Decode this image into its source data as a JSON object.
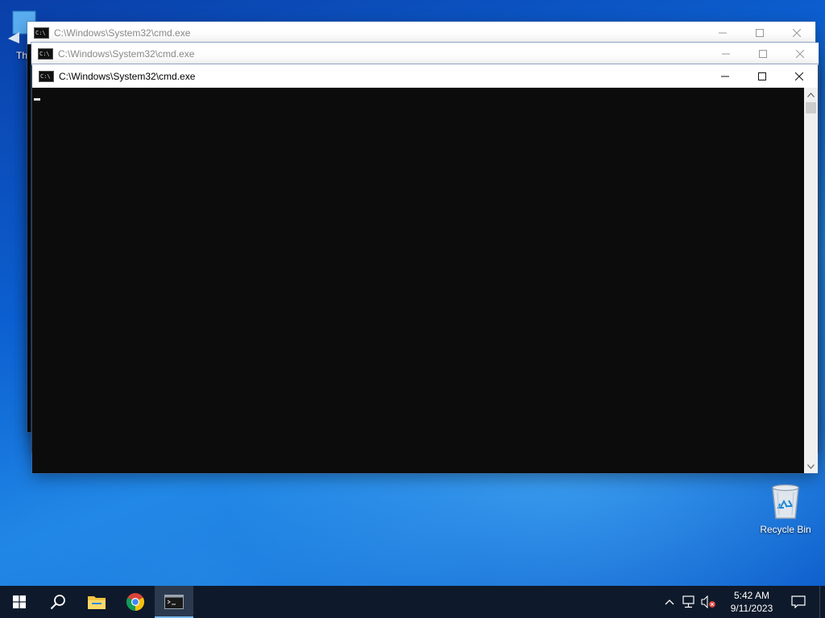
{
  "desktop": {
    "icons": [
      {
        "label": "Th"
      },
      {
        "label": "Recycle Bin"
      }
    ]
  },
  "windows": [
    {
      "title": "C:\\Windows\\System32\\cmd.exe",
      "state": "inactive"
    },
    {
      "title": "C:\\Windows\\System32\\cmd.exe",
      "state": "inactive"
    },
    {
      "title": "C:\\Windows\\System32\\cmd.exe",
      "state": "active"
    }
  ],
  "taskbar": {
    "items": [
      {
        "icon": "windows-start-icon"
      },
      {
        "icon": "search-icon"
      },
      {
        "icon": "file-explorer-icon"
      },
      {
        "icon": "chrome-icon"
      },
      {
        "icon": "command-prompt-icon",
        "active": true
      }
    ],
    "tray": {
      "icons": [
        "chevron-up-icon",
        "network-icon",
        "volume-muted-icon"
      ],
      "time": "5:42 AM",
      "date": "9/11/2023",
      "notification_icon": "action-center-icon"
    }
  },
  "colors": {
    "console_bg": "#0c0c0c",
    "taskbar_bg": "#0e1a2b",
    "titlebar_bg": "#ffffff",
    "active_indicator": "#76b9ed"
  }
}
